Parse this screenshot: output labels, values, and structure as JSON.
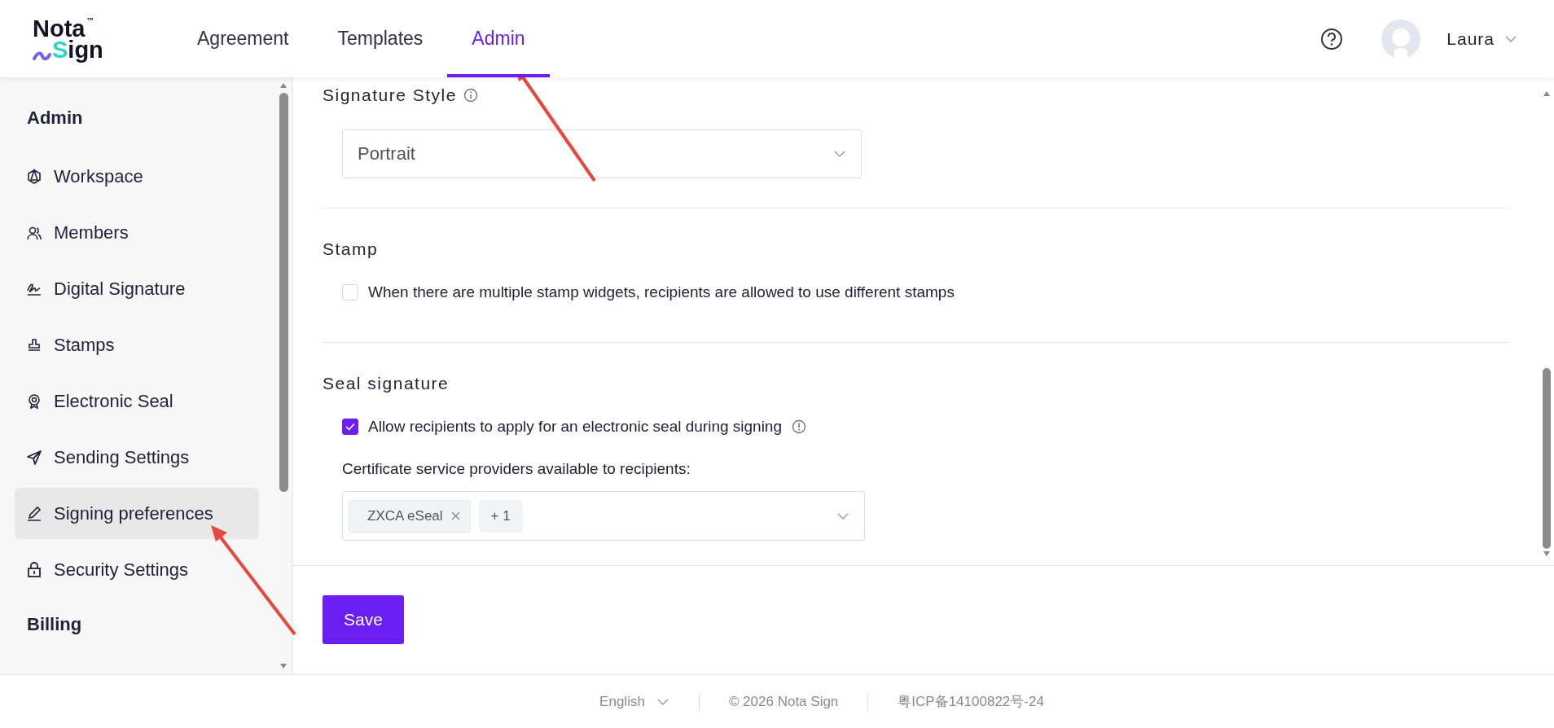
{
  "header": {
    "logo": {
      "line1": "Nota",
      "line2": "Sign",
      "mark": "™"
    },
    "nav": [
      {
        "label": "Agreement",
        "selected": false
      },
      {
        "label": "Templates",
        "selected": false
      },
      {
        "label": "Admin",
        "selected": true
      }
    ],
    "user": {
      "name": "Laura"
    }
  },
  "sidebar": {
    "sections": [
      {
        "title": "Admin",
        "items": [
          {
            "label": "Workspace",
            "kind": "workspace",
            "selected": false
          },
          {
            "label": "Members",
            "kind": "members",
            "selected": false
          },
          {
            "label": "Digital Signature",
            "kind": "signature",
            "selected": false
          },
          {
            "label": "Stamps",
            "kind": "stamp",
            "selected": false
          },
          {
            "label": "Electronic Seal",
            "kind": "seal",
            "selected": false
          },
          {
            "label": "Sending Settings",
            "kind": "send",
            "selected": false
          },
          {
            "label": "Signing preferences",
            "kind": "pen",
            "selected": true
          },
          {
            "label": "Security Settings",
            "kind": "lock",
            "selected": false
          }
        ]
      },
      {
        "title": "Billing"
      }
    ]
  },
  "settings": {
    "signature_style": {
      "title": "Signature Style",
      "select": {
        "value": "Portrait"
      }
    },
    "stamp": {
      "title": "Stamp",
      "checkbox": {
        "label": "When there are multiple stamp widgets, recipients are allowed to use different stamps",
        "checked": false
      }
    },
    "seal": {
      "title": "Seal signature",
      "checkbox": {
        "label": "Allow recipients to apply for an electronic seal during signing",
        "checked": true
      },
      "providers_label": "Certificate service providers available to recipients:",
      "providers": [
        {
          "label": "ZXCA eSeal",
          "removable": true
        },
        {
          "label": "+ 1",
          "removable": false
        }
      ]
    }
  },
  "save_button": "Save",
  "footer": {
    "language": "English",
    "copyright": "© 2026 Nota Sign",
    "icp": "粤ICP备14100822号-24"
  }
}
